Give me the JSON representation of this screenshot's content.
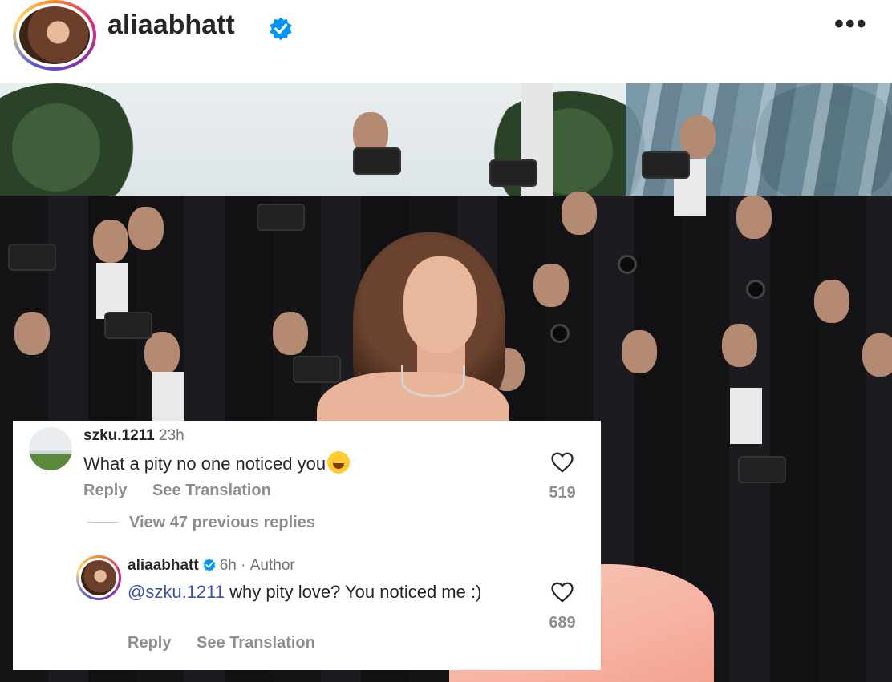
{
  "header": {
    "username": "aliaabhatt",
    "verified_icon": "verified-badge-icon",
    "more_label": "•••"
  },
  "photo": {
    "alt_subject": ""
  },
  "comment": {
    "username": "szku.1211",
    "time": "23h",
    "text": "What a pity no one noticed you",
    "emoji": "😂",
    "reply_label": "Reply",
    "translate_label": "See Translation",
    "likes": "519"
  },
  "view_replies": "View 47 previous replies",
  "reply": {
    "username": "aliaabhatt",
    "time": "6h",
    "separator": "·",
    "author_label": "Author",
    "mention": "@szku.1211",
    "text": " why pity love? You noticed me :)",
    "reply_label": "Reply",
    "translate_label": "See Translation",
    "likes": "689"
  },
  "colors": {
    "verified_blue": "#0095f6",
    "mention_blue": "#3a50a8",
    "muted_gray": "#8e8e8e"
  }
}
